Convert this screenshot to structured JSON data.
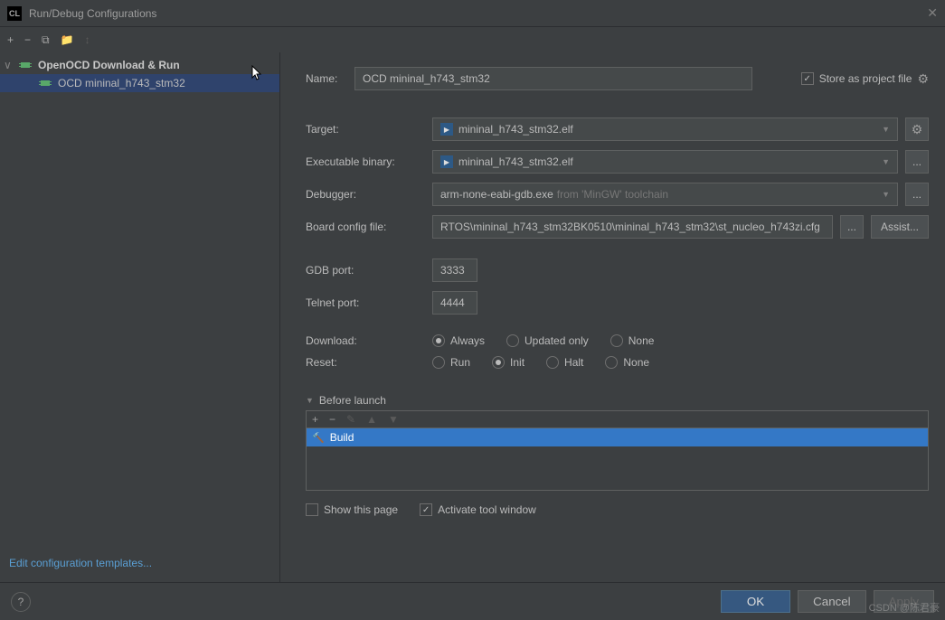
{
  "window": {
    "title": "Run/Debug Configurations"
  },
  "tree": {
    "group": "OpenOCD Download & Run",
    "item": "OCD mininal_h743_stm32"
  },
  "form": {
    "name_label": "Name:",
    "name_value": "OCD mininal_h743_stm32",
    "store_label": "Store as project file",
    "target_label": "Target:",
    "target_value": "mininal_h743_stm32.elf",
    "exec_label": "Executable binary:",
    "exec_value": "mininal_h743_stm32.elf",
    "debugger_label": "Debugger:",
    "debugger_value": "arm-none-eabi-gdb.exe",
    "debugger_sub": "from 'MinGW' toolchain",
    "board_label": "Board config file:",
    "board_value": "RTOS\\mininal_h743_stm32BK0510\\mininal_h743_stm32\\st_nucleo_h743zi.cfg",
    "assist_btn": "Assist...",
    "gdb_port_label": "GDB port:",
    "gdb_port": "3333",
    "telnet_port_label": "Telnet port:",
    "telnet_port": "4444",
    "download_label": "Download:",
    "download_opts": [
      "Always",
      "Updated only",
      "None"
    ],
    "reset_label": "Reset:",
    "reset_opts": [
      "Run",
      "Init",
      "Halt",
      "None"
    ],
    "before_launch": "Before launch",
    "build_item": "Build",
    "show_page": "Show this page",
    "activate_tool": "Activate tool window"
  },
  "footer": {
    "ok": "OK",
    "cancel": "Cancel",
    "apply": "Apply"
  },
  "sidebar": {
    "edit_templates": "Edit configuration templates..."
  },
  "ellipsis": "...",
  "watermark": "CSDN @陈君豪"
}
